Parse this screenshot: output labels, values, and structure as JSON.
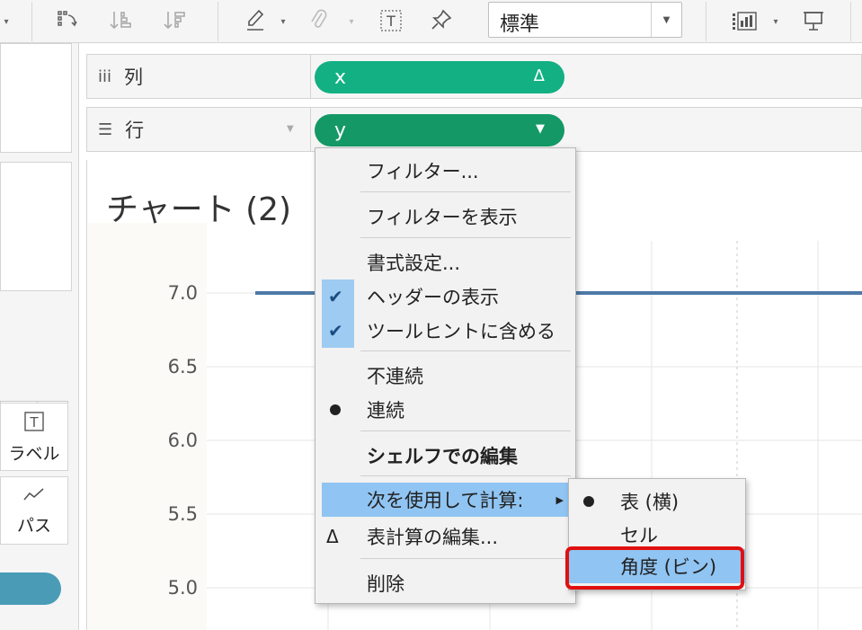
{
  "toolbar": {
    "icons": [
      "swap-icon",
      "sort-ascending-icon",
      "sort-descending-icon",
      "highlight-pen-icon",
      "paperclip-icon",
      "text-label-icon",
      "pin-icon",
      "show-me-icon",
      "presentation-icon"
    ],
    "fit_select": "標準"
  },
  "left_pane": {
    "label_button": "ラベル",
    "path_button": "パス"
  },
  "shelves": {
    "columns": {
      "label": "列",
      "pill": "x",
      "pill_icon": "Δ",
      "pill_color": "#12b082"
    },
    "rows": {
      "label": "行",
      "pill": "y",
      "pill_color": "#149966"
    }
  },
  "view": {
    "title": "チャート (2)",
    "yaxis_ticks": [
      "7.0",
      "6.5",
      "6.0",
      "5.5",
      "5.0"
    ]
  },
  "chart_data": {
    "type": "line",
    "title": "チャート (2)",
    "y_ticks": [
      7.0,
      6.5,
      6.0,
      5.5,
      5.0
    ],
    "series": [
      {
        "values": [
          7.0,
          7.0
        ]
      }
    ],
    "ylim": [
      5.0,
      7.0
    ],
    "line_color": "#4e79a7"
  },
  "context_menu": {
    "items": [
      {
        "label": "フィルター..."
      },
      {
        "label": "フィルターを表示"
      },
      {
        "label": "書式設定..."
      },
      {
        "label": "ヘッダーの表示",
        "checked": true
      },
      {
        "label": "ツールヒントに含める",
        "checked": true
      },
      {
        "label": "不連続"
      },
      {
        "label": "連続",
        "selected": true
      },
      {
        "label": "シェルフでの編集"
      },
      {
        "label": "次を使用して計算:",
        "has_submenu": true,
        "highlighted": true
      },
      {
        "label": "表計算の編集...",
        "icon": "Δ"
      },
      {
        "label": "削除"
      }
    ],
    "submenu": [
      {
        "label": "表 (横)",
        "selected": true
      },
      {
        "label": "セル"
      },
      {
        "label": "角度 (ビン)",
        "highlighted": true
      }
    ]
  },
  "colors": {
    "menu_highlight": "#90c4f2",
    "annotation_red": "#e01010"
  }
}
